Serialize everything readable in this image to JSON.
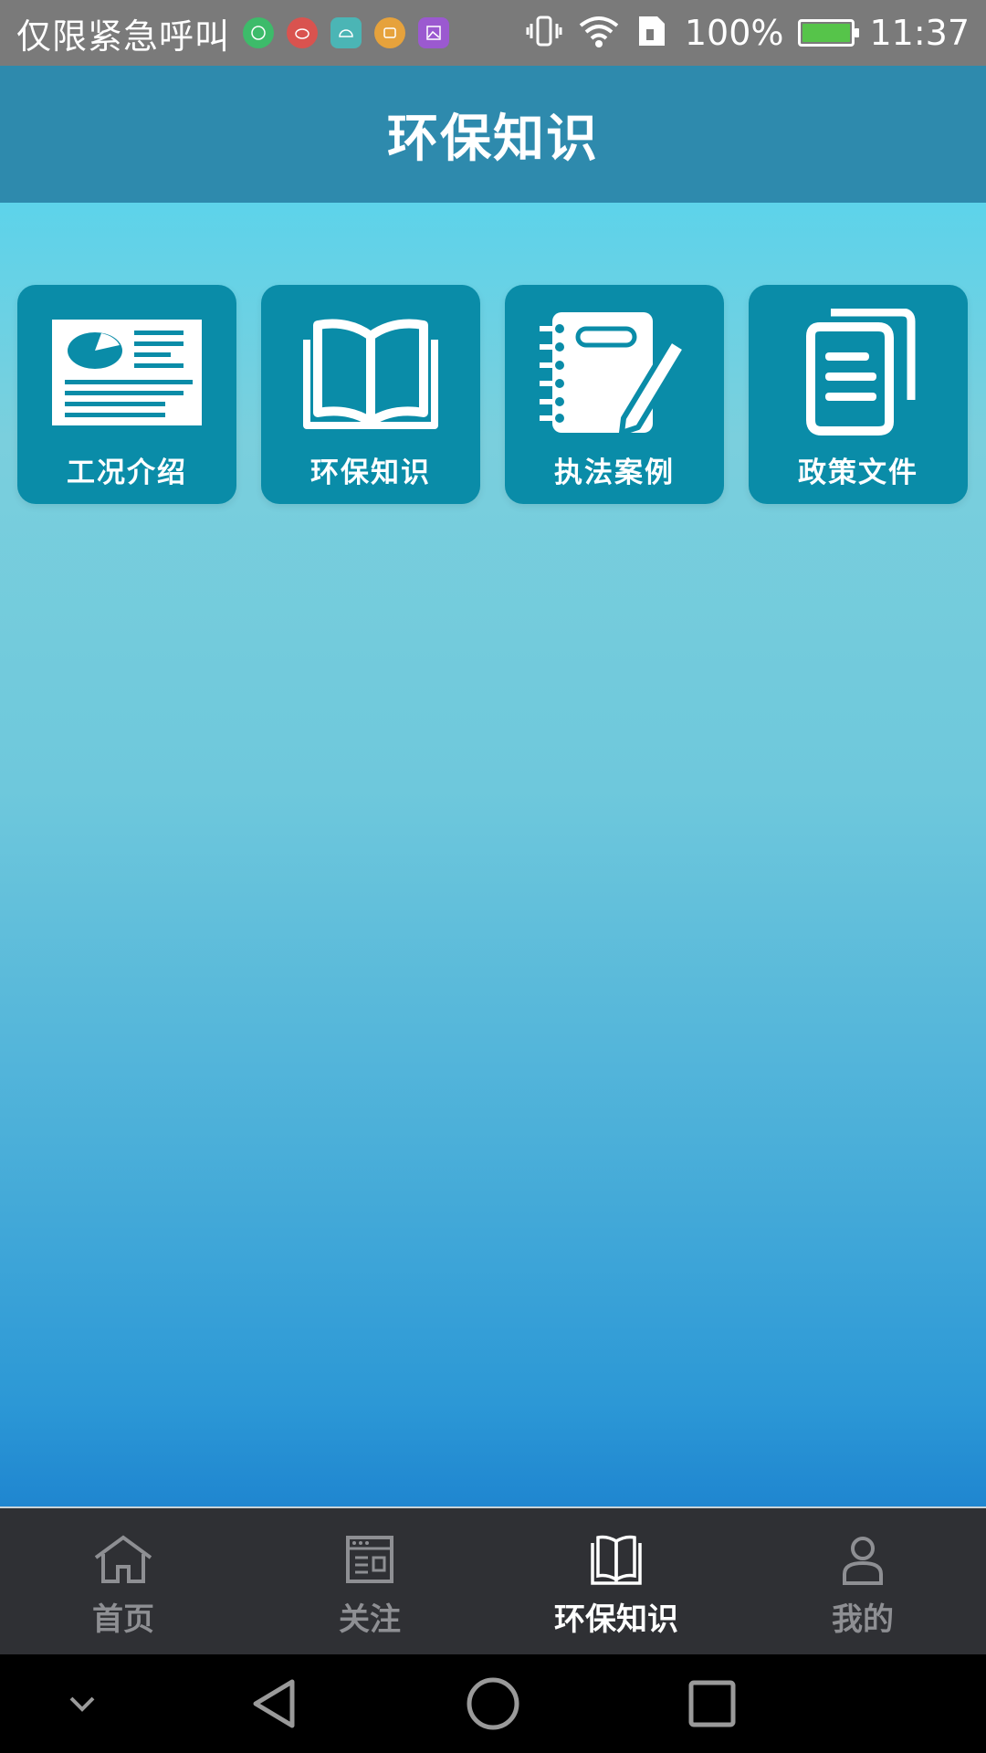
{
  "status_bar": {
    "carrier": "仅限紧急呼叫",
    "battery_percent": "100%",
    "time": "11:37",
    "notification_icons": [
      {
        "name": "wechat-icon",
        "color": "#3dbb6a"
      },
      {
        "name": "weibo-icon",
        "color": "#d9534f"
      },
      {
        "name": "android-icon",
        "color": "#4bb5b5"
      },
      {
        "name": "app-icon",
        "color": "#e6a23c"
      },
      {
        "name": "gallery-icon",
        "color": "#9b59d0"
      }
    ],
    "system_icons": [
      "vibrate-icon",
      "wifi-icon",
      "sim-icon",
      "battery-charging-icon"
    ]
  },
  "header": {
    "title": "环保知识"
  },
  "tiles": [
    {
      "label": "工况介绍",
      "icon": "chart-document-icon"
    },
    {
      "label": "环保知识",
      "icon": "open-book-icon"
    },
    {
      "label": "执法案例",
      "icon": "notebook-pen-icon"
    },
    {
      "label": "政策文件",
      "icon": "documents-icon"
    }
  ],
  "bottom_nav": {
    "items": [
      {
        "label": "首页",
        "icon": "home-icon",
        "active": false
      },
      {
        "label": "关注",
        "icon": "news-icon",
        "active": false
      },
      {
        "label": "环保知识",
        "icon": "book-icon",
        "active": true
      },
      {
        "label": "我的",
        "icon": "user-icon",
        "active": false
      }
    ]
  },
  "system_nav": [
    "collapse-icon",
    "back-icon",
    "home-circle-icon",
    "recents-icon"
  ],
  "colors": {
    "header_bg": "#2e8aad",
    "tile_bg": "#0a8ca8",
    "nav_bg": "#2f3034",
    "nav_inactive": "#8e8f93",
    "nav_active": "#ffffff"
  }
}
